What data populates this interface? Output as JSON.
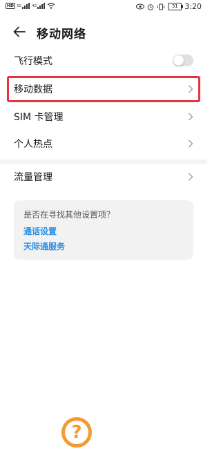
{
  "status_bar": {
    "hd_label": "HD",
    "net1": "3G",
    "net2": "4G",
    "battery": "31",
    "time": "3:20"
  },
  "header": {
    "title": "移动网络"
  },
  "settings": {
    "airplane_mode": {
      "label": "飞行模式",
      "enabled": false
    },
    "mobile_data": {
      "label": "移动数据"
    },
    "sim_manage": {
      "label": "SIM 卡管理"
    },
    "hotspot": {
      "label": "个人热点"
    },
    "traffic": {
      "label": "流量管理"
    }
  },
  "help_card": {
    "question": "是否在寻找其他设置项？",
    "link1": "通话设置",
    "link2": "天际通服务"
  },
  "help_button": {
    "label": "?"
  },
  "colors": {
    "highlight": "#e4343f",
    "link": "#2b8ee8",
    "help_fab": "#f39a32"
  }
}
